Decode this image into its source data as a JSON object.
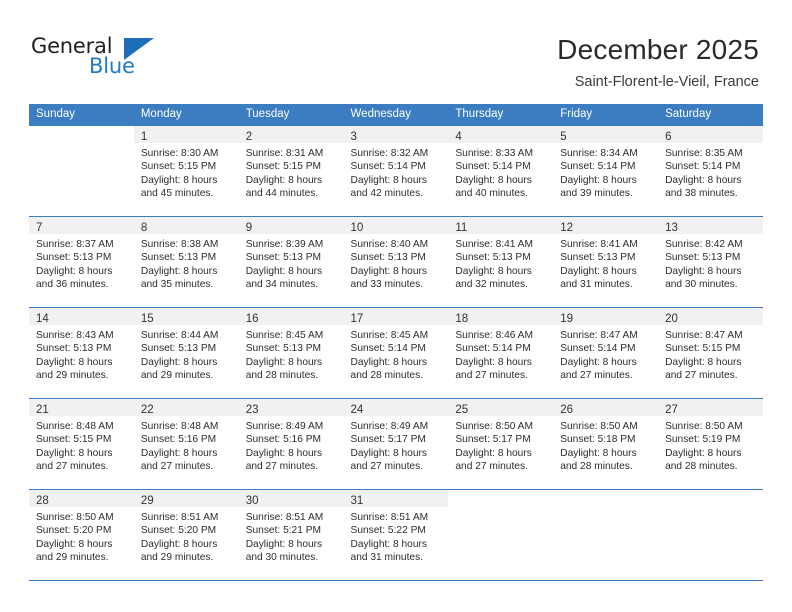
{
  "brand": {
    "name_top": "General",
    "name_bottom": "Blue",
    "triangle_icon": "triangle-icon",
    "accent_color": "#1e6eb8",
    "text_color": "#231f20"
  },
  "header": {
    "month_title": "December 2025",
    "location": "Saint-Florent-le-Vieil, France"
  },
  "theme": {
    "header_row_bg": "#3b7dc0",
    "header_row_text": "#ffffff",
    "daynum_bg": "#f1f1f1",
    "grid_line": "#3b7dc0",
    "cell_bg": "#ffffff",
    "body_text": "#2d2d2d"
  },
  "calendar": {
    "weekday_headers": [
      "Sunday",
      "Monday",
      "Tuesday",
      "Wednesday",
      "Thursday",
      "Friday",
      "Saturday"
    ],
    "labels": {
      "sunrise_prefix": "Sunrise:",
      "sunset_prefix": "Sunset:",
      "daylight_prefix": "Daylight:"
    },
    "weeks": [
      [
        {
          "day": "",
          "blank": true,
          "lines": []
        },
        {
          "day": "1",
          "lines": [
            "Sunrise: 8:30 AM",
            "Sunset: 5:15 PM",
            "Daylight: 8 hours",
            "and 45 minutes."
          ]
        },
        {
          "day": "2",
          "lines": [
            "Sunrise: 8:31 AM",
            "Sunset: 5:15 PM",
            "Daylight: 8 hours",
            "and 44 minutes."
          ]
        },
        {
          "day": "3",
          "lines": [
            "Sunrise: 8:32 AM",
            "Sunset: 5:14 PM",
            "Daylight: 8 hours",
            "and 42 minutes."
          ]
        },
        {
          "day": "4",
          "lines": [
            "Sunrise: 8:33 AM",
            "Sunset: 5:14 PM",
            "Daylight: 8 hours",
            "and 40 minutes."
          ]
        },
        {
          "day": "5",
          "lines": [
            "Sunrise: 8:34 AM",
            "Sunset: 5:14 PM",
            "Daylight: 8 hours",
            "and 39 minutes."
          ]
        },
        {
          "day": "6",
          "lines": [
            "Sunrise: 8:35 AM",
            "Sunset: 5:14 PM",
            "Daylight: 8 hours",
            "and 38 minutes."
          ]
        }
      ],
      [
        {
          "day": "7",
          "lines": [
            "Sunrise: 8:37 AM",
            "Sunset: 5:13 PM",
            "Daylight: 8 hours",
            "and 36 minutes."
          ]
        },
        {
          "day": "8",
          "lines": [
            "Sunrise: 8:38 AM",
            "Sunset: 5:13 PM",
            "Daylight: 8 hours",
            "and 35 minutes."
          ]
        },
        {
          "day": "9",
          "lines": [
            "Sunrise: 8:39 AM",
            "Sunset: 5:13 PM",
            "Daylight: 8 hours",
            "and 34 minutes."
          ]
        },
        {
          "day": "10",
          "lines": [
            "Sunrise: 8:40 AM",
            "Sunset: 5:13 PM",
            "Daylight: 8 hours",
            "and 33 minutes."
          ]
        },
        {
          "day": "11",
          "lines": [
            "Sunrise: 8:41 AM",
            "Sunset: 5:13 PM",
            "Daylight: 8 hours",
            "and 32 minutes."
          ]
        },
        {
          "day": "12",
          "lines": [
            "Sunrise: 8:41 AM",
            "Sunset: 5:13 PM",
            "Daylight: 8 hours",
            "and 31 minutes."
          ]
        },
        {
          "day": "13",
          "lines": [
            "Sunrise: 8:42 AM",
            "Sunset: 5:13 PM",
            "Daylight: 8 hours",
            "and 30 minutes."
          ]
        }
      ],
      [
        {
          "day": "14",
          "lines": [
            "Sunrise: 8:43 AM",
            "Sunset: 5:13 PM",
            "Daylight: 8 hours",
            "and 29 minutes."
          ]
        },
        {
          "day": "15",
          "lines": [
            "Sunrise: 8:44 AM",
            "Sunset: 5:13 PM",
            "Daylight: 8 hours",
            "and 29 minutes."
          ]
        },
        {
          "day": "16",
          "lines": [
            "Sunrise: 8:45 AM",
            "Sunset: 5:13 PM",
            "Daylight: 8 hours",
            "and 28 minutes."
          ]
        },
        {
          "day": "17",
          "lines": [
            "Sunrise: 8:45 AM",
            "Sunset: 5:14 PM",
            "Daylight: 8 hours",
            "and 28 minutes."
          ]
        },
        {
          "day": "18",
          "lines": [
            "Sunrise: 8:46 AM",
            "Sunset: 5:14 PM",
            "Daylight: 8 hours",
            "and 27 minutes."
          ]
        },
        {
          "day": "19",
          "lines": [
            "Sunrise: 8:47 AM",
            "Sunset: 5:14 PM",
            "Daylight: 8 hours",
            "and 27 minutes."
          ]
        },
        {
          "day": "20",
          "lines": [
            "Sunrise: 8:47 AM",
            "Sunset: 5:15 PM",
            "Daylight: 8 hours",
            "and 27 minutes."
          ]
        }
      ],
      [
        {
          "day": "21",
          "lines": [
            "Sunrise: 8:48 AM",
            "Sunset: 5:15 PM",
            "Daylight: 8 hours",
            "and 27 minutes."
          ]
        },
        {
          "day": "22",
          "lines": [
            "Sunrise: 8:48 AM",
            "Sunset: 5:16 PM",
            "Daylight: 8 hours",
            "and 27 minutes."
          ]
        },
        {
          "day": "23",
          "lines": [
            "Sunrise: 8:49 AM",
            "Sunset: 5:16 PM",
            "Daylight: 8 hours",
            "and 27 minutes."
          ]
        },
        {
          "day": "24",
          "lines": [
            "Sunrise: 8:49 AM",
            "Sunset: 5:17 PM",
            "Daylight: 8 hours",
            "and 27 minutes."
          ]
        },
        {
          "day": "25",
          "lines": [
            "Sunrise: 8:50 AM",
            "Sunset: 5:17 PM",
            "Daylight: 8 hours",
            "and 27 minutes."
          ]
        },
        {
          "day": "26",
          "lines": [
            "Sunrise: 8:50 AM",
            "Sunset: 5:18 PM",
            "Daylight: 8 hours",
            "and 28 minutes."
          ]
        },
        {
          "day": "27",
          "lines": [
            "Sunrise: 8:50 AM",
            "Sunset: 5:19 PM",
            "Daylight: 8 hours",
            "and 28 minutes."
          ]
        }
      ],
      [
        {
          "day": "28",
          "lines": [
            "Sunrise: 8:50 AM",
            "Sunset: 5:20 PM",
            "Daylight: 8 hours",
            "and 29 minutes."
          ]
        },
        {
          "day": "29",
          "lines": [
            "Sunrise: 8:51 AM",
            "Sunset: 5:20 PM",
            "Daylight: 8 hours",
            "and 29 minutes."
          ]
        },
        {
          "day": "30",
          "lines": [
            "Sunrise: 8:51 AM",
            "Sunset: 5:21 PM",
            "Daylight: 8 hours",
            "and 30 minutes."
          ]
        },
        {
          "day": "31",
          "lines": [
            "Sunrise: 8:51 AM",
            "Sunset: 5:22 PM",
            "Daylight: 8 hours",
            "and 31 minutes."
          ]
        },
        {
          "day": "",
          "blank": true,
          "lines": []
        },
        {
          "day": "",
          "blank": true,
          "lines": []
        },
        {
          "day": "",
          "blank": true,
          "lines": []
        }
      ]
    ]
  }
}
